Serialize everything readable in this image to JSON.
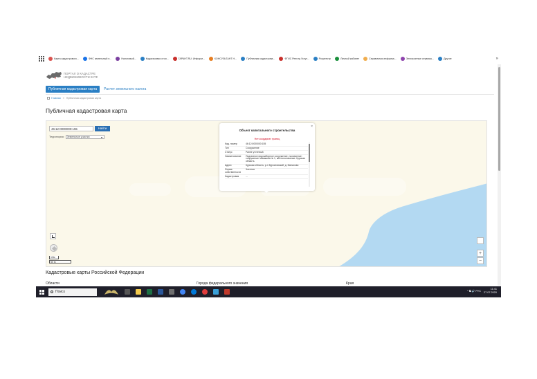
{
  "bookmarks": [
    {
      "label": "Карта кадастрового...",
      "color": "#d9534f"
    },
    {
      "label": "ФНС земельный н...",
      "color": "#1a73e8"
    },
    {
      "label": "Налоговый...",
      "color": "#7b3fa0"
    },
    {
      "label": "Кадастровая стои...",
      "color": "#2a7fc4"
    },
    {
      "label": "ГАРАНТ.RU: Информ...",
      "color": "#c9302c"
    },
    {
      "label": "КОНСУЛЬТАНТ Н...",
      "color": "#e67e22"
    },
    {
      "label": "Публичная кадастрова...",
      "color": "#2a7fc4"
    },
    {
      "label": "ФГИС Реестр.Услуг...",
      "color": "#c9302c"
    },
    {
      "label": "Росреестр",
      "color": "#2a7fc4"
    },
    {
      "label": "Личный кабинет",
      "color": "#1a8f3c"
    },
    {
      "label": "Справочная информа...",
      "color": "#f0ad4e"
    },
    {
      "label": "Электронные сервисы...",
      "color": "#8e44ad"
    },
    {
      "label": "Другие",
      "color": "#2a7fc4"
    }
  ],
  "bookmarks_more": "»",
  "header": {
    "logo_line1": "ПОРТАЛ О КАДАСТРЕ",
    "logo_line2": "НЕДВИЖИМОСТИ В РФ"
  },
  "tabs": {
    "active": "Публичная кадастровая карта",
    "other": "Расчет земельного налога"
  },
  "breadcrumbs": {
    "home": "Главная",
    "separator": "»",
    "current": "Публичная кадастровая карта"
  },
  "page_title": "Публичная кадастровая карта",
  "map": {
    "search_value": "46:12:0000000:155",
    "search_button": "Найти",
    "filter_label": "Территория:",
    "filter_value": "Земельные участки"
  },
  "popup": {
    "title": "Объект капитального строительства",
    "close": "×",
    "warning": "Нет координат границ",
    "rows": [
      {
        "k": "Кад. номер",
        "v": "46:12:0000000:155"
      },
      {
        "k": "Тип",
        "v": "Сооружение"
      },
      {
        "k": "Статус",
        "v": "Ранее учтенный"
      },
      {
        "k": "Наименование",
        "v": "Подземное водозаборное сооружение, назначение: сооружение/ скважина № 1, местоположение: Курская область"
      },
      {
        "k": "Адрес",
        "v": "Курская область, р-н Курчатовский, д. Малахово"
      },
      {
        "k": "Форма собственности",
        "v": "Частная"
      },
      {
        "k": "Кадастровая",
        "v": "..."
      }
    ]
  },
  "scale": {
    "zoom_level": "13м",
    "distance": "50 м"
  },
  "zoom": {
    "plus": "+",
    "minus": "−"
  },
  "bottom": {
    "section_title": "Кадастровые карты Российской Федерации",
    "col1": "Области",
    "col2": "Города федерального значения",
    "col3": "Края"
  },
  "taskbar": {
    "search_label": "Поиск",
    "tray_text": "^ ⧉ 🔊 РУС",
    "time": "11:41",
    "date": "27.07.2020"
  },
  "colors": {
    "accent": "#2a7fc4",
    "water": "#b3d9f2",
    "map_land": "#fbf8ea",
    "warning": "#d0021b",
    "taskbar": "#1f1f2a"
  }
}
